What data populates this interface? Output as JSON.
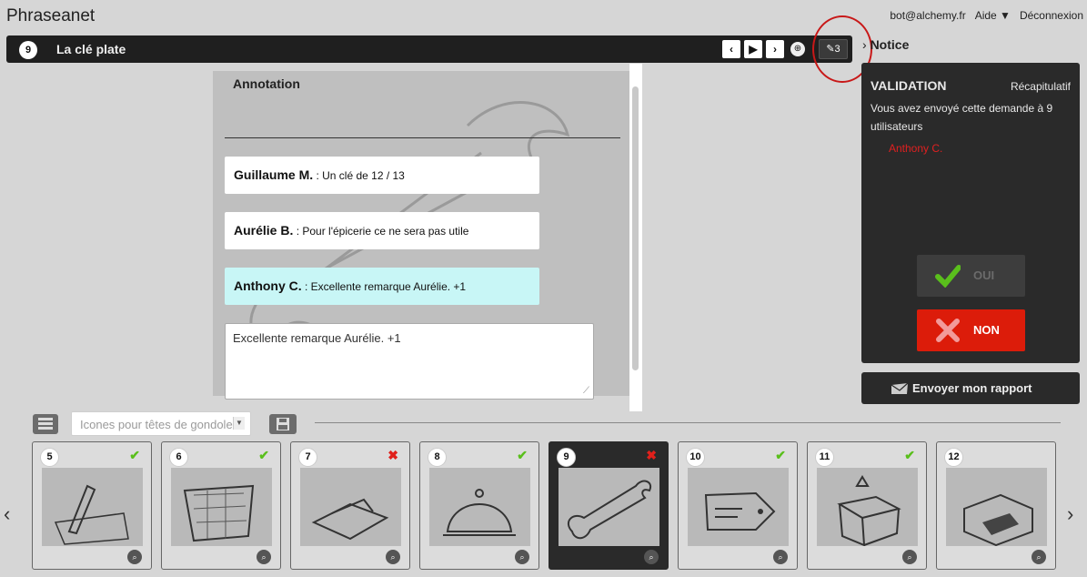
{
  "app": {
    "title": "Phraseanet"
  },
  "user_menu": {
    "email": "bot@alchemy.fr",
    "help": "Aide ▼",
    "logout": "Déconnexion"
  },
  "document": {
    "index": "9",
    "title": "La clé plate",
    "annotation_count": "3"
  },
  "annotation": {
    "title": "Annotation",
    "comments": [
      {
        "author": "Guillaume M.",
        "text": " : Un clé de 12 / 13"
      },
      {
        "author": "Aurélie B.",
        "text": " : Pour l'épicerie ce ne sera pas utile"
      },
      {
        "author": "Anthony C.",
        "text": " : Excellente remarque Aurélie. +1"
      }
    ],
    "input_value": "Excellente remarque Aurélie. +1"
  },
  "notice": {
    "label": "Notice"
  },
  "validation": {
    "title": "VALIDATION",
    "recap": "Récapitulatif",
    "text": "Vous avez envoyé cette demande à 9 utilisateurs",
    "user": "Anthony C.",
    "oui": "OUI",
    "non": "NON",
    "report": "Envoyer mon rapport"
  },
  "basket": {
    "selected": "Icones pour têtes de gondole"
  },
  "thumbnails": [
    {
      "num": "5",
      "status": "ok"
    },
    {
      "num": "6",
      "status": "ok"
    },
    {
      "num": "7",
      "status": "ko"
    },
    {
      "num": "8",
      "status": "ok"
    },
    {
      "num": "9",
      "status": "ko",
      "active": true
    },
    {
      "num": "10",
      "status": "ok"
    },
    {
      "num": "11",
      "status": "ok"
    },
    {
      "num": "12",
      "status": "none"
    }
  ],
  "thumb_art": [
    "pencil",
    "basket",
    "folder",
    "cloche",
    "wrench",
    "tag",
    "box",
    "printer"
  ],
  "colors": {
    "accent_red": "#dc1c0a",
    "ok_green": "#5abf1c",
    "dark": "#2a2a2a"
  }
}
